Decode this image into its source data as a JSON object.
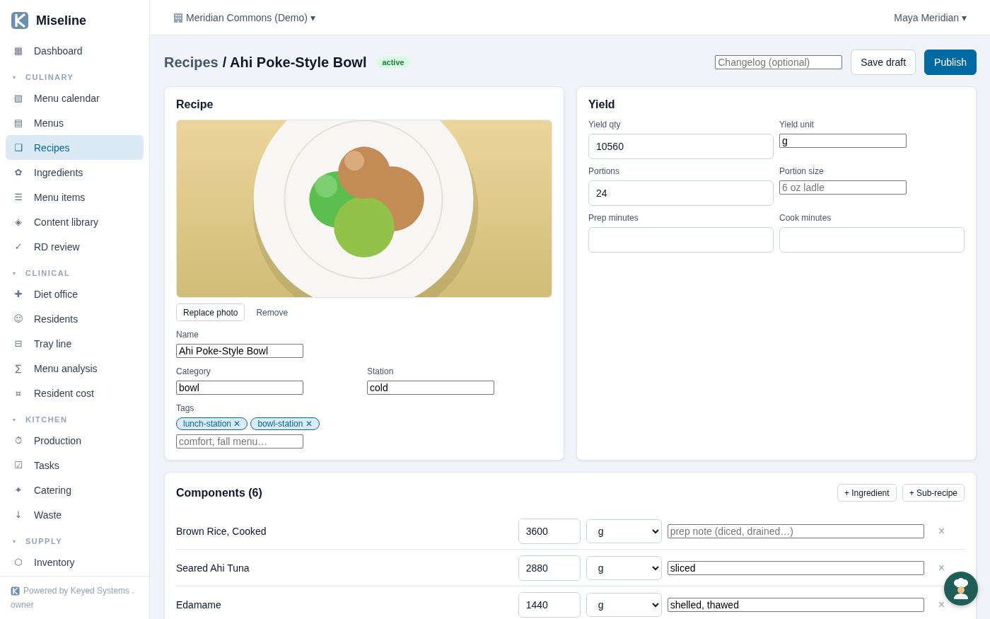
{
  "brand": {
    "name": "Miseline"
  },
  "sidebar": {
    "groups": [
      {
        "items": [
          {
            "icon": "▦",
            "label": "Dashboard",
            "selected": false
          }
        ]
      },
      {
        "caret": "▾",
        "heading": "CULINARY",
        "items": [
          {
            "icon": "▧",
            "label": "Menu calendar",
            "selected": false
          },
          {
            "icon": "▤",
            "label": "Menus",
            "selected": false
          },
          {
            "icon": "❑",
            "label": "Recipes",
            "selected": true
          },
          {
            "icon": "✿",
            "label": "Ingredients",
            "selected": false
          },
          {
            "icon": "☰",
            "label": "Menu items",
            "selected": false
          },
          {
            "icon": "◈",
            "label": "Content library",
            "selected": false
          },
          {
            "icon": "✓",
            "label": "RD review",
            "selected": false
          }
        ]
      },
      {
        "caret": "▾",
        "heading": "CLINICAL",
        "items": [
          {
            "icon": "✚",
            "label": "Diet office",
            "selected": false
          },
          {
            "icon": "☺",
            "label": "Residents",
            "selected": false
          },
          {
            "icon": "⊟",
            "label": "Tray line",
            "selected": false
          },
          {
            "icon": "∑",
            "label": "Menu analysis",
            "selected": false
          },
          {
            "icon": "¤",
            "label": "Resident cost",
            "selected": false
          }
        ]
      },
      {
        "caret": "▾",
        "heading": "KITCHEN",
        "items": [
          {
            "icon": "⏱",
            "label": "Production",
            "selected": false
          },
          {
            "icon": "☑",
            "label": "Tasks",
            "selected": false
          },
          {
            "icon": "✦",
            "label": "Catering",
            "selected": false
          },
          {
            "icon": "↓",
            "label": "Waste",
            "selected": false
          }
        ]
      },
      {
        "caret": "▾",
        "heading": "SUPPLY",
        "items": [
          {
            "icon": "⬡",
            "label": "Inventory",
            "selected": false
          }
        ]
      }
    ],
    "footer": {
      "text": "Powered by Keyed Systems .",
      "role": "owner"
    }
  },
  "topbar": {
    "org": "Meridian Commons (Demo) ▾",
    "user": "Maya Meridian ▾"
  },
  "header": {
    "breadcrumb": "Recipes",
    "title": "/ Ahi Poke-Style Bowl",
    "status": "active",
    "changelog": {
      "placeholder": "Changelog (optional)"
    },
    "save": "Save draft",
    "publish": "Publish"
  },
  "recipe": {
    "title": "Recipe",
    "replace": "Replace photo",
    "remove": "Remove",
    "name": {
      "label": "Name",
      "value": "Ahi Poke-Style Bowl"
    },
    "category": {
      "label": "Category",
      "value": "bowl"
    },
    "station": {
      "label": "Station",
      "value": "cold"
    },
    "tags": {
      "label": "Tags",
      "items": [
        "lunch-station ✕",
        "bowl-station ✕"
      ],
      "placeholder": "comfort, fall menu…"
    }
  },
  "yield": {
    "title": "Yield",
    "fields": [
      {
        "kind": "box",
        "label": "Yield qty",
        "value": "10560"
      },
      {
        "kind": "plain",
        "label": "Yield unit",
        "value": "g"
      },
      {
        "kind": "box",
        "label": "Portions",
        "value": "24"
      },
      {
        "kind": "plain",
        "label": "Portion size",
        "placeholder": "6 oz ladle"
      },
      {
        "kind": "box",
        "label": "Prep minutes"
      },
      {
        "kind": "box",
        "label": "Cook minutes"
      }
    ]
  },
  "components": {
    "title": "Components (6)",
    "add_ingredient": "+ Ingredient",
    "add_subrecipe": "+ Sub-recipe",
    "rows": [
      {
        "name": "Brown Rice, Cooked",
        "qty": "3600",
        "unit": "g",
        "note_placeholder": "prep note (diced, drained…)",
        "remove": "×"
      },
      {
        "name": "Seared Ahi Tuna",
        "qty": "2880",
        "unit": "g",
        "note": "sliced",
        "remove": "×"
      },
      {
        "name": "Edamame",
        "qty": "1440",
        "unit": "g",
        "note": "shelled, thawed",
        "remove": "×"
      }
    ]
  }
}
